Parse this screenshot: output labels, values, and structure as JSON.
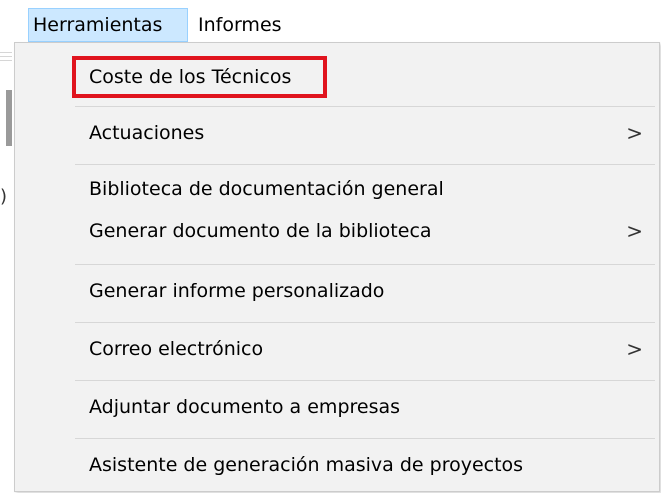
{
  "menubar": {
    "items": [
      {
        "label": "Herramientas"
      },
      {
        "label": "Informes"
      }
    ]
  },
  "background": {
    "fragment_char": ")"
  },
  "dropdown": {
    "items": [
      {
        "label": "Coste de los Técnicos",
        "submenu": false
      },
      {
        "label": "Actuaciones",
        "submenu": true
      },
      {
        "label": "Biblioteca de documentación general",
        "submenu": false
      },
      {
        "label": "Generar documento de la biblioteca",
        "submenu": true
      },
      {
        "label": "Generar informe personalizado",
        "submenu": false
      },
      {
        "label": "Correo electrónico",
        "submenu": true
      },
      {
        "label": "Adjuntar documento a empresas",
        "submenu": false
      },
      {
        "label": "Asistente de generación masiva de proyectos",
        "submenu": false
      }
    ],
    "submenu_glyph": ">"
  },
  "annotation": {
    "highlight_color": "#e0141e",
    "highlighted_item": "Coste de los Técnicos"
  },
  "colors": {
    "menubar_active_bg": "#cce8ff",
    "menubar_active_border": "#99d1ff",
    "dropdown_bg": "#f2f2f2"
  }
}
